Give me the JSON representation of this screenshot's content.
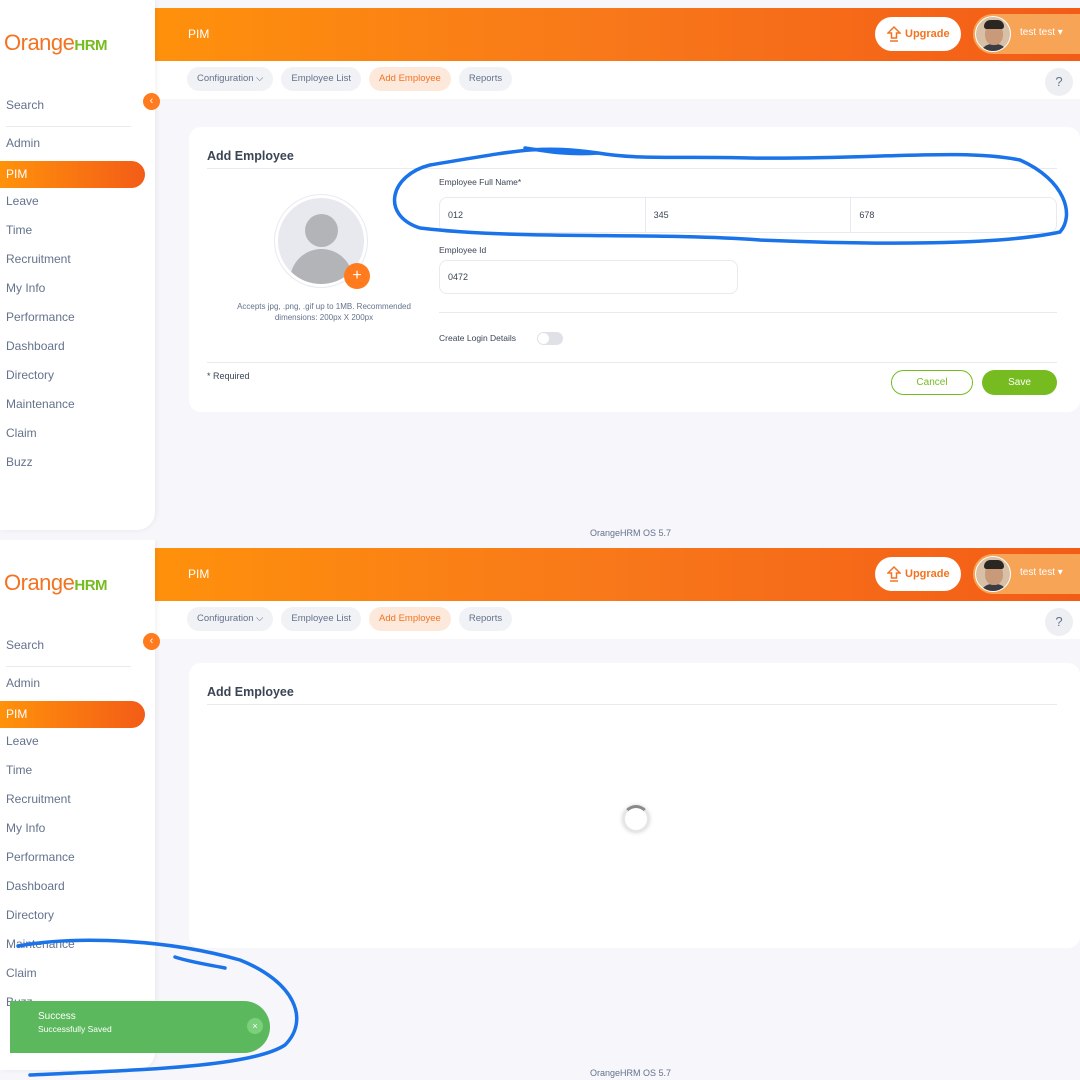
{
  "brand": {
    "name": "Orange",
    "suffix": "HRM"
  },
  "sidebar": {
    "search_placeholder": "Search",
    "items": [
      {
        "label": "Admin"
      },
      {
        "label": "PIM"
      },
      {
        "label": "Leave"
      },
      {
        "label": "Time"
      },
      {
        "label": "Recruitment"
      },
      {
        "label": "My Info"
      },
      {
        "label": "Performance"
      },
      {
        "label": "Dashboard"
      },
      {
        "label": "Directory"
      },
      {
        "label": "Maintenance"
      },
      {
        "label": "Claim"
      },
      {
        "label": "Buzz"
      }
    ],
    "active_item": "PIM",
    "collapse_icon": "chevron-left-icon"
  },
  "header": {
    "title": "PIM",
    "upgrade_label": "Upgrade",
    "upgrade_icon": "upgrade-arrow-icon",
    "user_name": "test test",
    "user_menu_icon": "caret-down-icon"
  },
  "tabs": [
    {
      "label": "Configuration",
      "has_dropdown": true
    },
    {
      "label": "Employee List"
    },
    {
      "label": "Add Employee",
      "active": true
    },
    {
      "label": "Reports"
    }
  ],
  "help_label": "?",
  "form": {
    "title": "Add Employee",
    "photo_hint": "Accepts jpg, .png, .gif up to 1MB. Recommended dimensions: 200px X 200px",
    "photo_add_label": "+",
    "full_name_label": "Employee Full Name*",
    "first_name": "012",
    "middle_name": "345",
    "last_name": "678",
    "employee_id_label": "Employee Id",
    "employee_id": "0472",
    "create_login_label": "Create Login Details",
    "create_login_enabled": false,
    "required_note": "* Required",
    "cancel_label": "Cancel",
    "save_label": "Save"
  },
  "loading": {
    "title": "Add Employee",
    "state": "loading"
  },
  "footer": "OrangeHRM OS 5.7",
  "toast": {
    "title": "Success",
    "message": "Successfully Saved",
    "close_label": "×"
  },
  "colors": {
    "brand_orange": "#f37321",
    "brand_green": "#76bc21",
    "success": "#5cb85c",
    "annotation": "#1a73e8"
  }
}
